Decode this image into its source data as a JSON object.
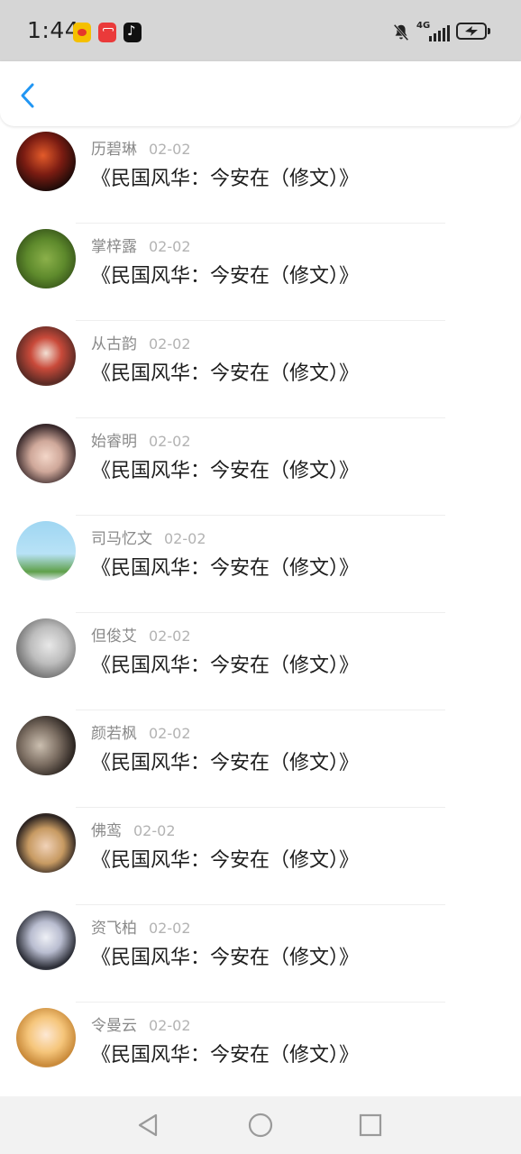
{
  "status_bar": {
    "time": "1:44",
    "network": "4G",
    "app_icons": [
      "weibo-icon",
      "red-app-icon",
      "tiktok-icon"
    ],
    "indicators": [
      "mute-bell-icon",
      "signal-icon",
      "battery-charging-icon"
    ]
  },
  "header": {
    "back_icon": "chevron-left-icon",
    "accent_color": "#2196f3"
  },
  "comments": [
    {
      "name": "历碧琳",
      "date": "02-02",
      "text": "《民国风华：今安在（修文）》"
    },
    {
      "name": "掌梓露",
      "date": "02-02",
      "text": "《民国风华：今安在（修文）》"
    },
    {
      "name": "从古韵",
      "date": "02-02",
      "text": "《民国风华：今安在（修文）》"
    },
    {
      "name": "始睿明",
      "date": "02-02",
      "text": "《民国风华：今安在（修文）》"
    },
    {
      "name": "司马忆文",
      "date": "02-02",
      "text": "《民国风华：今安在（修文）》"
    },
    {
      "name": "但俊艾",
      "date": "02-02",
      "text": "《民国风华：今安在（修文）》"
    },
    {
      "name": "颜若枫",
      "date": "02-02",
      "text": "《民国风华：今安在（修文）》"
    },
    {
      "name": "佛鸾",
      "date": "02-02",
      "text": "《民国风华：今安在（修文）》"
    },
    {
      "name": "资飞柏",
      "date": "02-02",
      "text": "《民国风华：今安在（修文）》"
    },
    {
      "name": "令曼云",
      "date": "02-02",
      "text": "《民国风华：今安在（修文）》"
    }
  ],
  "nav_bar": {
    "buttons": [
      "back-triangle-icon",
      "home-circle-icon",
      "recents-square-icon"
    ]
  }
}
